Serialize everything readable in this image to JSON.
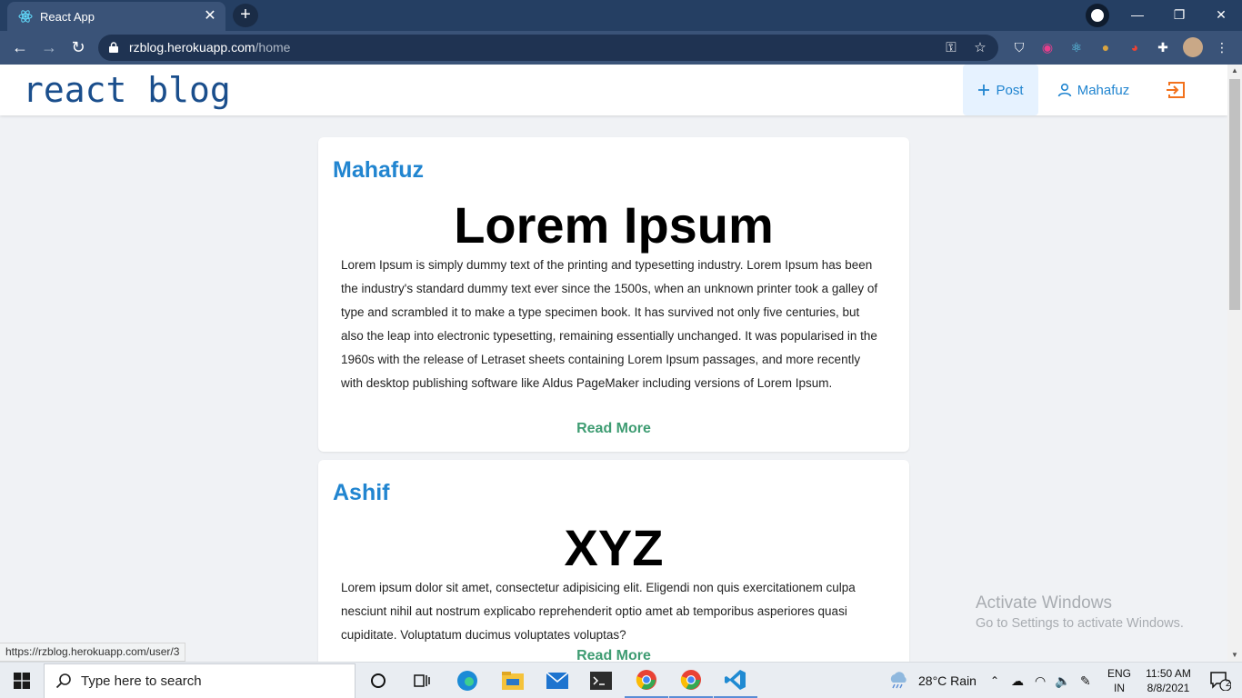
{
  "browser": {
    "tab_title": "React App",
    "url_host": "rzblog.herokuapp.com",
    "url_path": "/home",
    "status_url": "https://rzblog.herokuapp.com/user/3"
  },
  "header": {
    "brand": "react blog",
    "post_label": "Post",
    "user_label": "Mahafuz"
  },
  "posts": [
    {
      "author": "Mahafuz",
      "title": "Lorem Ipsum",
      "body": "Lorem Ipsum is simply dummy text of the printing and typesetting industry. Lorem Ipsum has been the industry's standard dummy text ever since the 1500s, when an unknown printer took a galley of type and scrambled it to make a type specimen book. It has survived not only five centuries, but also the leap into electronic typesetting, remaining essentially unchanged. It was popularised in the 1960s with the release of Letraset sheets containing Lorem Ipsum passages, and more recently with desktop publishing software like Aldus PageMaker including versions of Lorem Ipsum.",
      "read_more": "Read More"
    },
    {
      "author": "Ashif",
      "title": "XYZ",
      "body": "Lorem ipsum dolor sit amet, consectetur adipisicing elit. Eligendi non quis exercitationem culpa nesciunt nihil aut nostrum explicabo reprehenderit optio amet ab temporibus asperiores quasi cupiditate. Voluptatum ducimus voluptates voluptas?",
      "read_more": "Read More"
    }
  ],
  "watermark": {
    "line1": "Activate Windows",
    "line2": "Go to Settings to activate Windows."
  },
  "taskbar": {
    "search_placeholder": "Type here to search",
    "weather": "28°C  Rain",
    "lang_top": "ENG",
    "lang_bottom": "IN",
    "time": "11:50 AM",
    "date": "8/8/2021",
    "notification_count": "2"
  },
  "colors": {
    "accent": "#2185d0",
    "read_more": "#3e9c72",
    "brand": "#1a4e8c",
    "logout": "#f2711c"
  }
}
